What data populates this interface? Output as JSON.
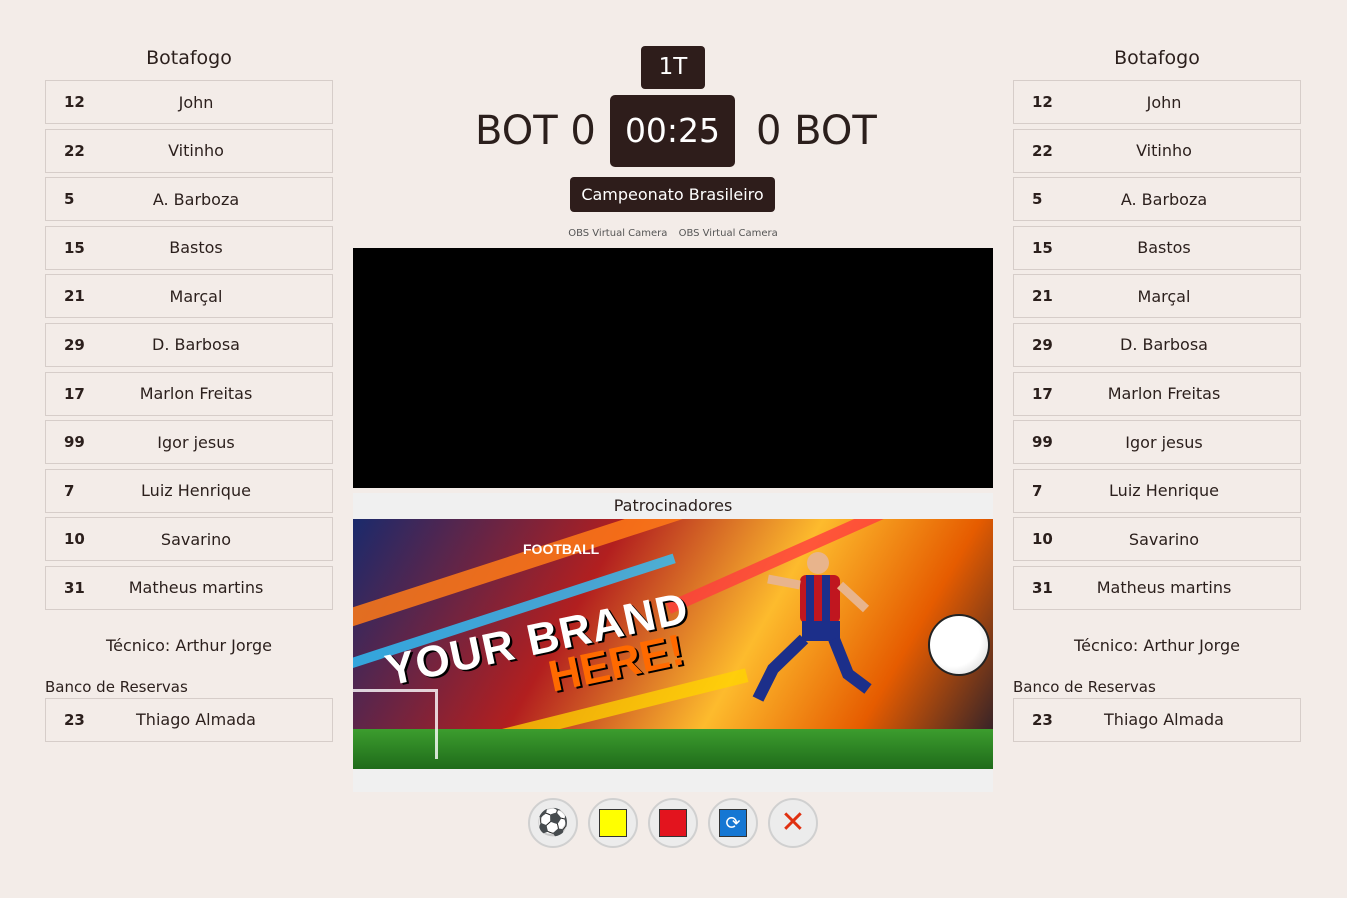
{
  "left_team": {
    "name": "Botafogo",
    "players": [
      {
        "num": "12",
        "name": "John"
      },
      {
        "num": "22",
        "name": "Vitinho"
      },
      {
        "num": "5",
        "name": "A. Barboza"
      },
      {
        "num": "15",
        "name": "Bastos"
      },
      {
        "num": "21",
        "name": "Marçal"
      },
      {
        "num": "29",
        "name": "D. Barbosa"
      },
      {
        "num": "17",
        "name": "Marlon Freitas"
      },
      {
        "num": "99",
        "name": "Igor jesus"
      },
      {
        "num": "7",
        "name": "Luiz Henrique"
      },
      {
        "num": "10",
        "name": "Savarino"
      },
      {
        "num": "31",
        "name": "Matheus martins"
      }
    ],
    "coach": "Técnico: Arthur Jorge",
    "bench_title": "Banco de Reservas",
    "bench": [
      {
        "num": "23",
        "name": "Thiago Almada"
      }
    ]
  },
  "right_team": {
    "name": "Botafogo",
    "players": [
      {
        "num": "12",
        "name": "John"
      },
      {
        "num": "22",
        "name": "Vitinho"
      },
      {
        "num": "5",
        "name": "A. Barboza"
      },
      {
        "num": "15",
        "name": "Bastos"
      },
      {
        "num": "21",
        "name": "Marçal"
      },
      {
        "num": "29",
        "name": "D. Barbosa"
      },
      {
        "num": "17",
        "name": "Marlon Freitas"
      },
      {
        "num": "99",
        "name": "Igor jesus"
      },
      {
        "num": "7",
        "name": "Luiz Henrique"
      },
      {
        "num": "10",
        "name": "Savarino"
      },
      {
        "num": "31",
        "name": "Matheus martins"
      }
    ],
    "coach": "Técnico: Arthur Jorge",
    "bench_title": "Banco de Reservas",
    "bench": [
      {
        "num": "23",
        "name": "Thiago Almada"
      }
    ]
  },
  "scoreboard": {
    "period": "1T",
    "home_score_text": "BOT 0",
    "away_score_text": "0 BOT",
    "clock": "00:25",
    "competition": "Campeonato Brasileiro"
  },
  "cameras": [
    "OBS Virtual Camera",
    "OBS Virtual Camera"
  ],
  "sponsors": {
    "title": "Patrocinadores",
    "banner_football": "FOOTBALL",
    "banner_line1": "YOUR BRAND",
    "banner_line2": "HERE!"
  },
  "actions": [
    {
      "name": "goal-button",
      "icon": "soccer-ball-icon"
    },
    {
      "name": "yellow-card-button",
      "icon": "yellow-card-icon"
    },
    {
      "name": "red-card-button",
      "icon": "red-card-icon"
    },
    {
      "name": "substitution-button",
      "icon": "substitution-icon"
    },
    {
      "name": "cancel-button",
      "icon": "close-icon"
    }
  ],
  "colors": {
    "background": "#f3ece8",
    "dark": "#2e1d1b",
    "yellow_card": "#ffff00",
    "red_card": "#e3141e",
    "substitution": "#1577d3",
    "cancel": "#e03010"
  }
}
